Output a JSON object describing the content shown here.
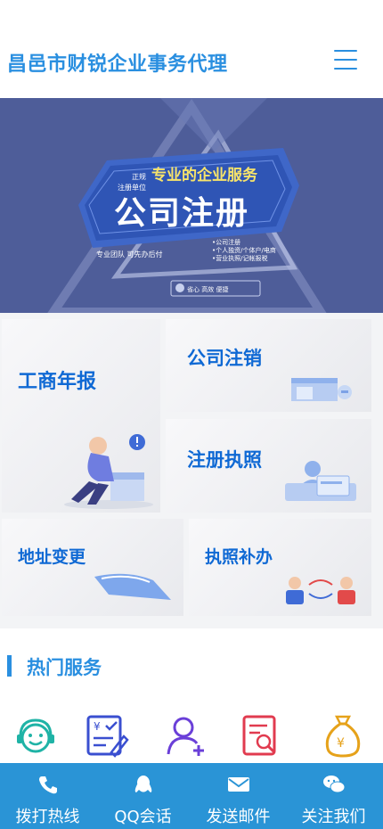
{
  "header": {
    "title": "昌邑市财锐企业事务代理"
  },
  "banner": {
    "small_line1": "正规",
    "small_line2": "注册单位",
    "subtitle": "专业的企业服务",
    "title": "公司注册",
    "left_text": "专业团队 可先办后付",
    "list": [
      "•公司注册",
      "•个人独资/个体户/电商",
      "•营业执照/记帐报税"
    ],
    "tags": "省心   高效   便捷"
  },
  "tiles": [
    {
      "label": "工商年报"
    },
    {
      "label": "公司注销"
    },
    {
      "label": "注册执照"
    },
    {
      "label": "地址变更"
    },
    {
      "label": "执照补办"
    }
  ],
  "hot": {
    "title": "热门服务"
  },
  "services": [
    {
      "icon": "customer-service-icon"
    },
    {
      "icon": "finance-form-icon"
    },
    {
      "icon": "add-user-icon"
    },
    {
      "icon": "document-search-icon"
    },
    {
      "icon": "money-bag-icon"
    }
  ],
  "bottom_nav": [
    {
      "label": "拨打热线",
      "icon": "phone-icon"
    },
    {
      "label": "QQ会话",
      "icon": "qq-icon"
    },
    {
      "label": "发送邮件",
      "icon": "mail-icon"
    },
    {
      "label": "关注我们",
      "icon": "wechat-icon"
    }
  ],
  "colors": {
    "brand": "#2a8fe0",
    "tile_label": "#0f69d4",
    "banner_bg": "#4e5d99",
    "bottom_bar": "#2a94d6"
  }
}
